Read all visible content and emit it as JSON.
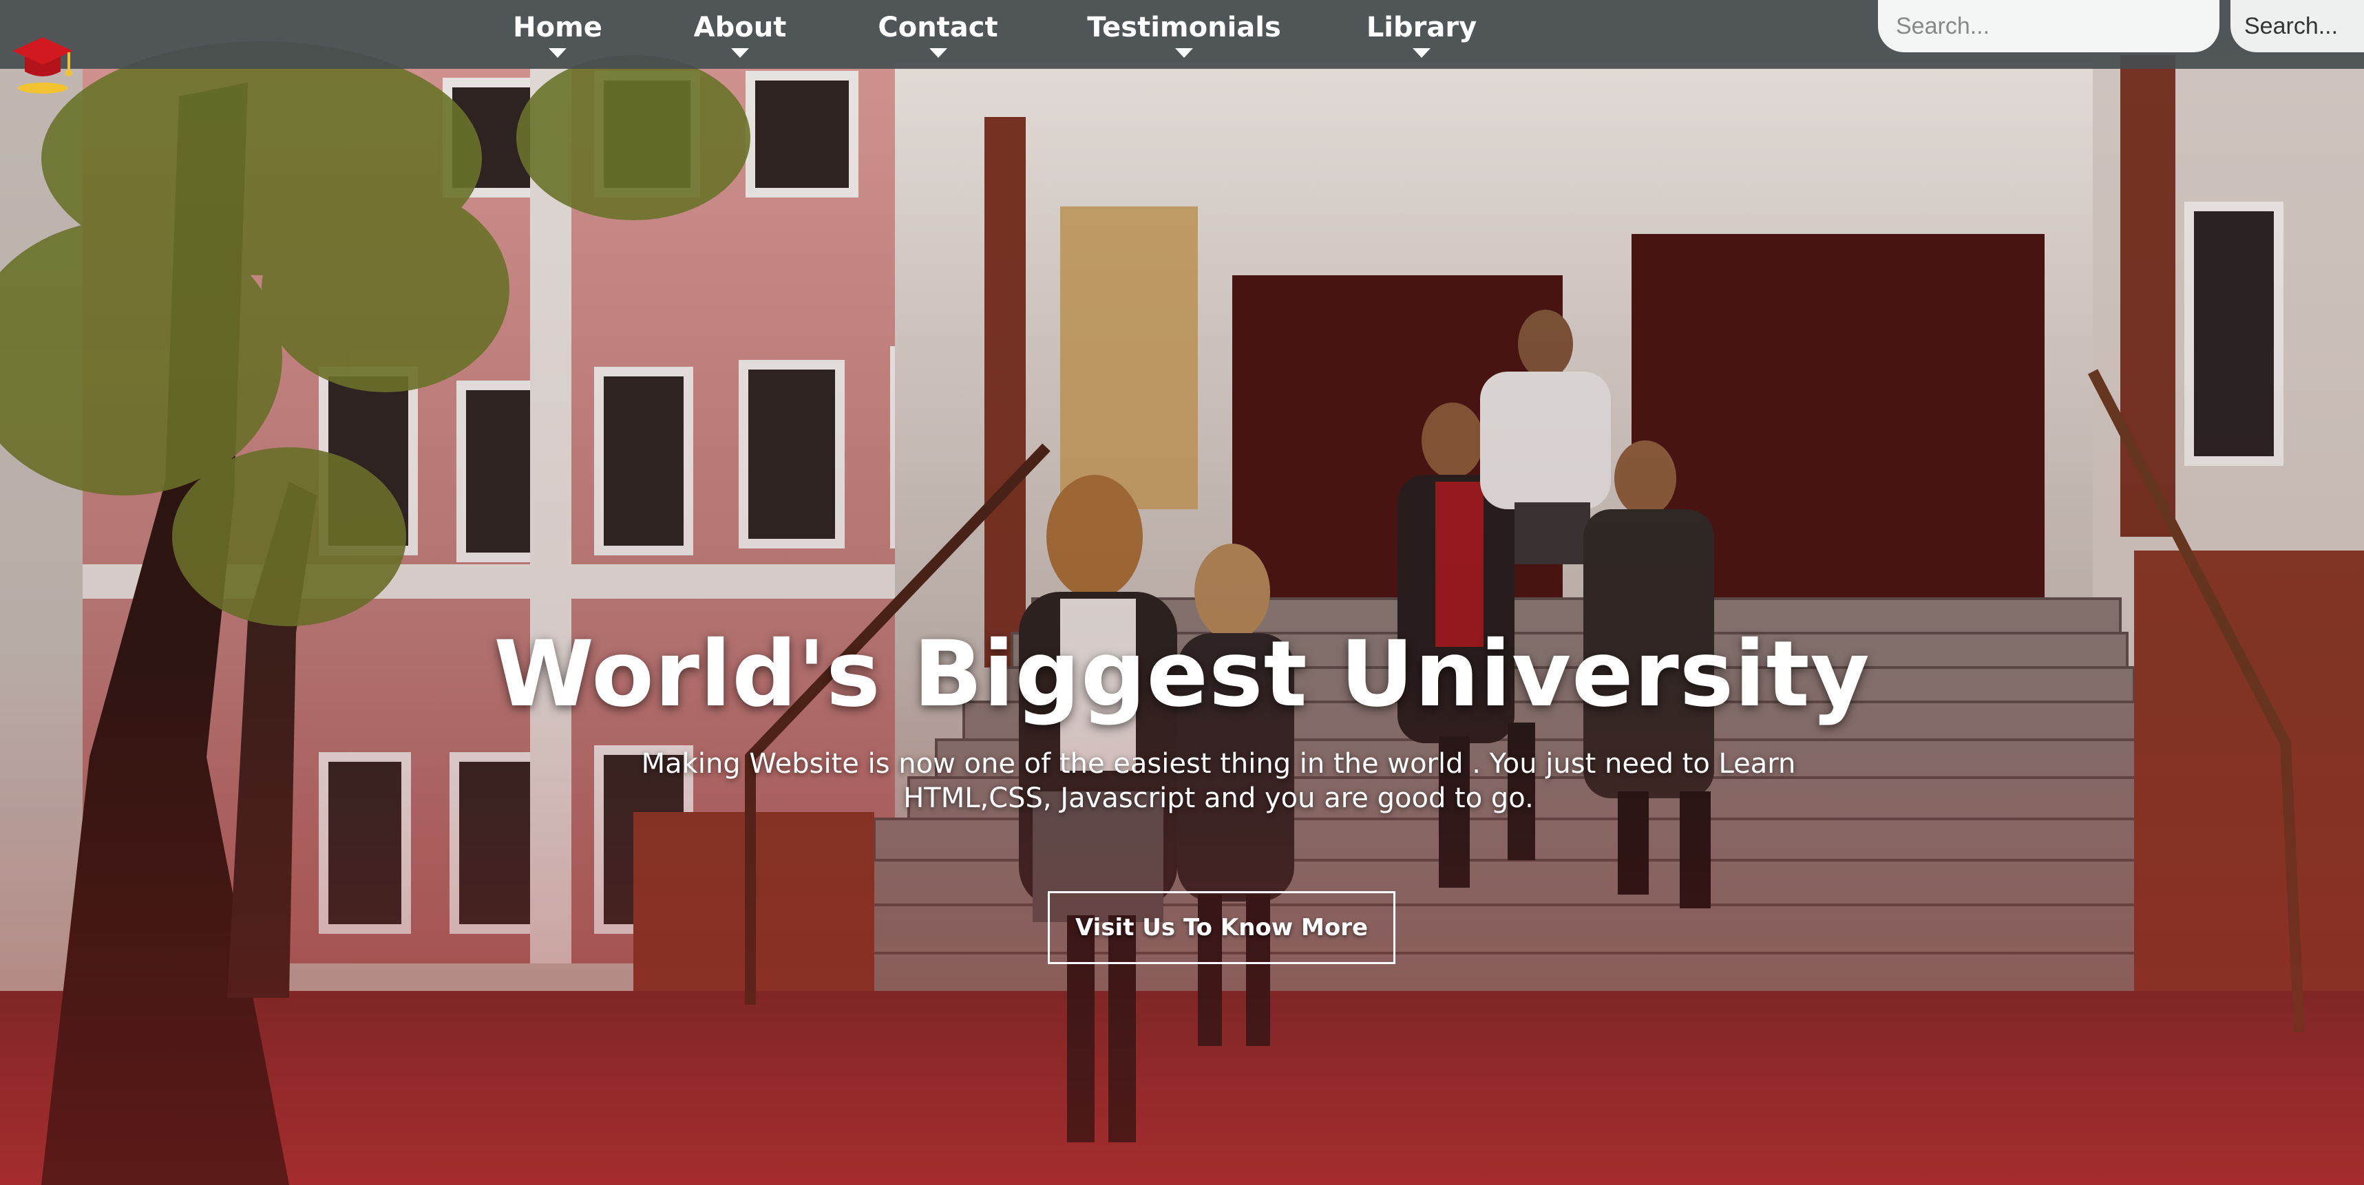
{
  "nav": {
    "items": [
      {
        "label": "Home"
      },
      {
        "label": "About"
      },
      {
        "label": "Contact"
      },
      {
        "label": "Testimonials"
      },
      {
        "label": "Library"
      }
    ]
  },
  "search": {
    "placeholder": "Search...",
    "button_label": "Search..."
  },
  "hero": {
    "title": "World's Biggest University",
    "subtitle": "Making Website is now one of the easiest thing in the world . You just need to Learn HTML,CSS, Javascript and you are good to go.",
    "cta_label": "Visit Us To Know More"
  },
  "icons": {
    "logo": "graduation-cap-icon",
    "dropdown": "caret-down-icon"
  },
  "colors": {
    "navbar": "#464c50",
    "accent": "#b11e24",
    "text": "#ffffff"
  }
}
